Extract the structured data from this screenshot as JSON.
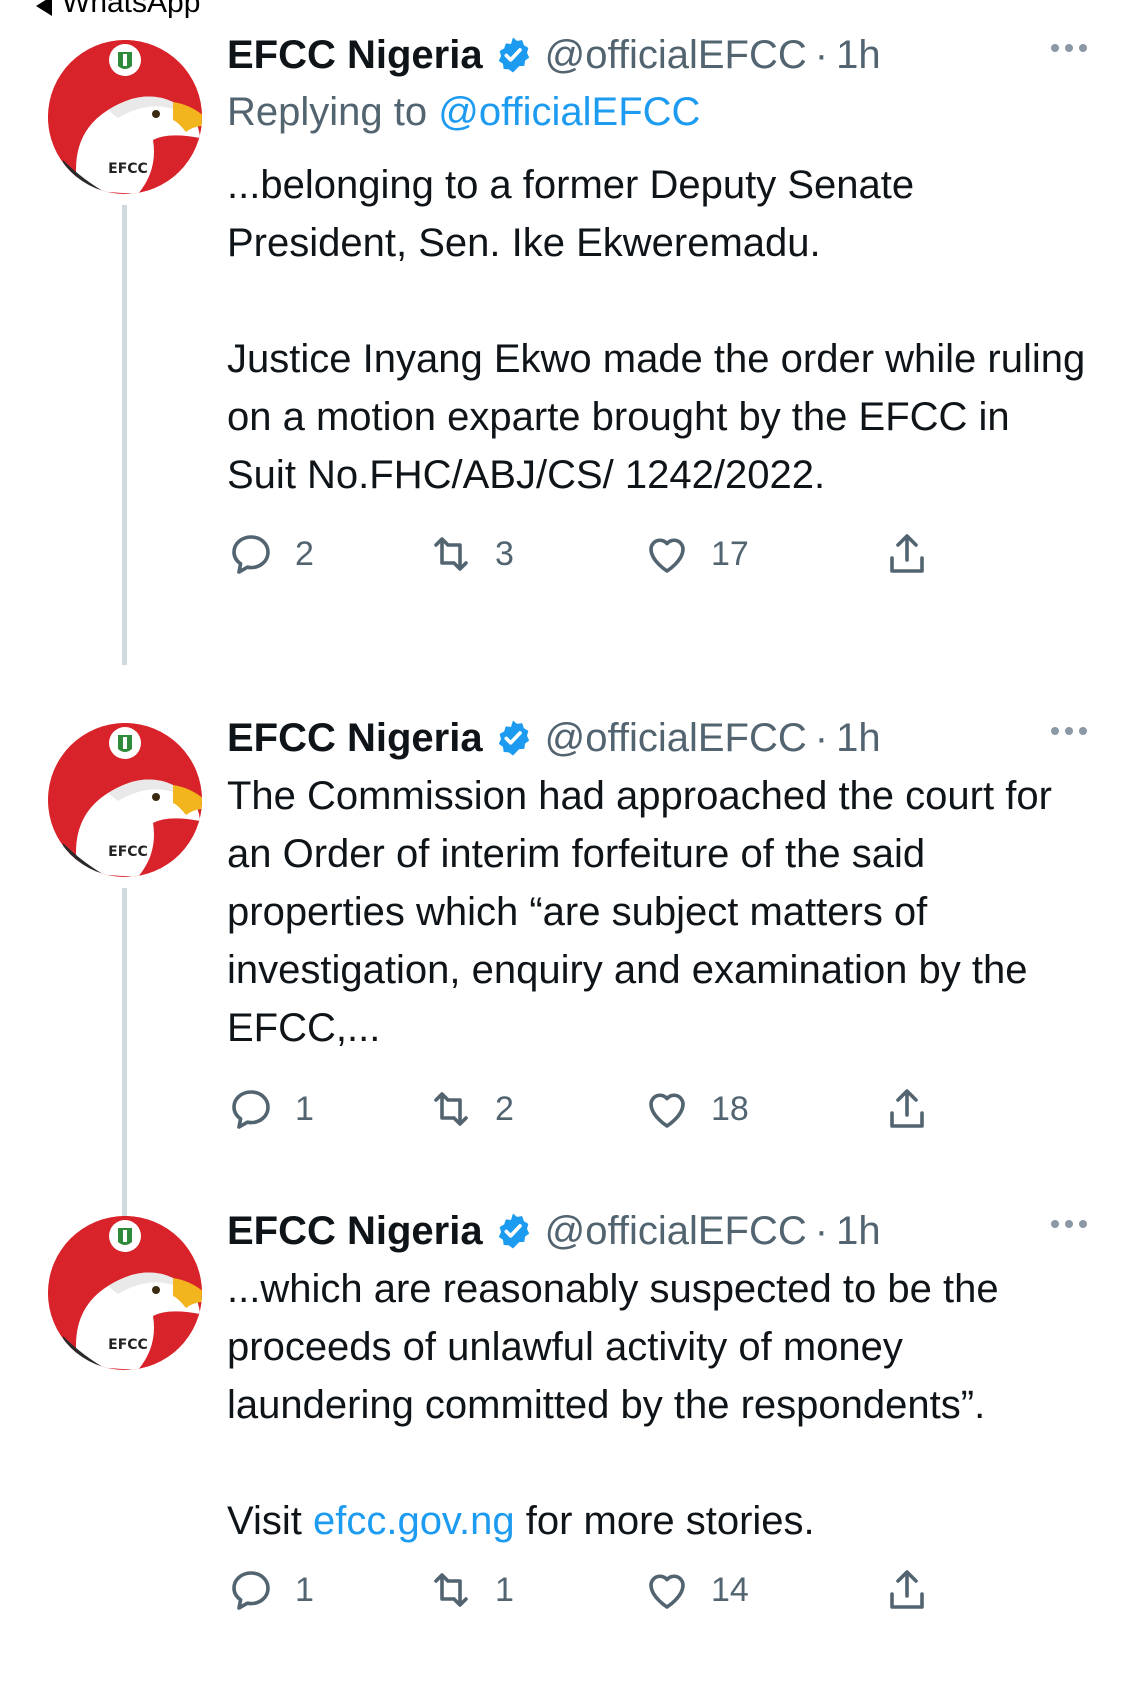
{
  "status_bar": {
    "back_app": "WhatsApp"
  },
  "colors": {
    "accent": "#1d9bf0",
    "text": "#0f1419",
    "muted": "#536471",
    "avatar_bg": "#d8232a",
    "line": "#cfd9de"
  },
  "avatar": {
    "badge_text": "EFCC"
  },
  "tweets": [
    {
      "name": "EFCC Nigeria",
      "handle": "@officialEFCC",
      "separator": "·",
      "time": "1h",
      "replying_prefix": "Replying to",
      "replying_to": "@officialEFCC",
      "paragraphs": [
        "...belonging to a former Deputy Senate President, Sen. Ike Ekweremadu.",
        "Justice Inyang Ekwo made the order while ruling on a motion exparte brought by the EFCC in Suit No.FHC/ABJ/CS/ 1242/2022."
      ],
      "replies": "2",
      "retweets": "3",
      "likes": "17"
    },
    {
      "name": "EFCC Nigeria",
      "handle": "@officialEFCC",
      "separator": "·",
      "time": "1h",
      "paragraphs": [
        "The Commission had approached the court for an Order of interim forfeiture of the said properties which “are subject matters of investigation, enquiry and examination by the EFCC,..."
      ],
      "replies": "1",
      "retweets": "2",
      "likes": "18"
    },
    {
      "name": "EFCC Nigeria",
      "handle": "@officialEFCC",
      "separator": "·",
      "time": "1h",
      "paragraphs": [
        "...which are reasonably suspected to be the proceeds of unlawful activity of money laundering committed by the respondents”."
      ],
      "visit_prefix": "Visit",
      "visit_link": "efcc.gov.ng",
      "visit_suffix": "for more stories.",
      "replies": "1",
      "retweets": "1",
      "likes": "14"
    }
  ],
  "icons": [
    "back-arrow-icon",
    "verified-badge-icon",
    "more-options-icon",
    "reply-icon",
    "retweet-icon",
    "like-icon",
    "share-icon",
    "efcc-logo-icon"
  ]
}
